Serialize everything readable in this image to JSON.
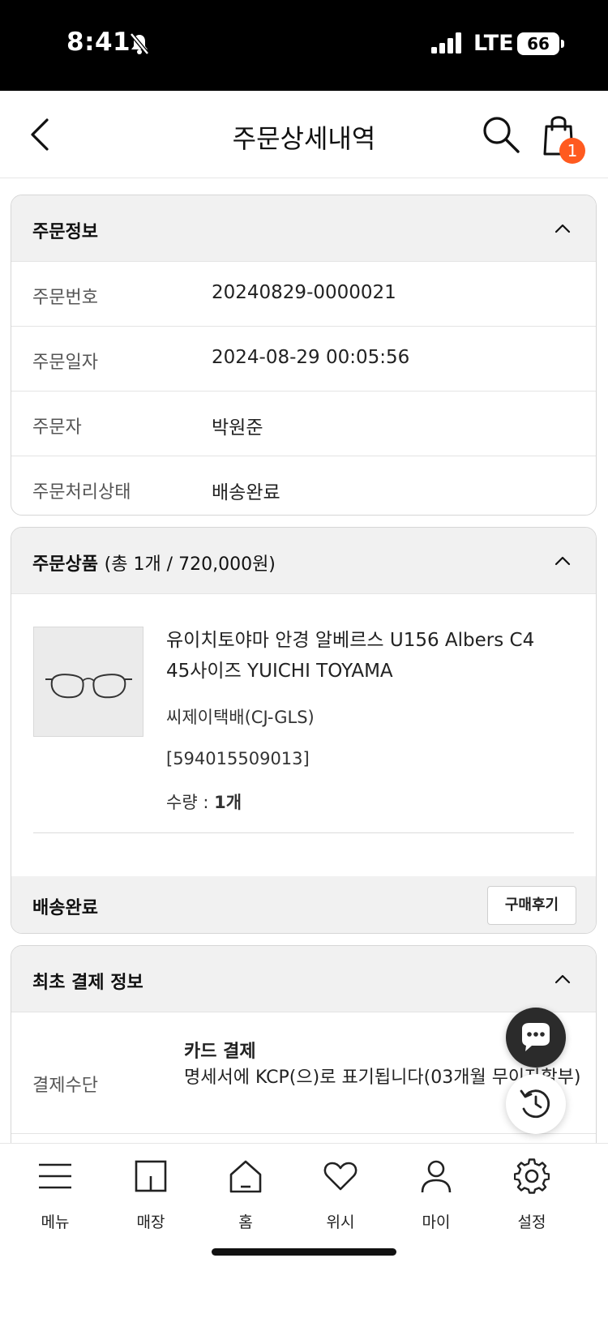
{
  "status_bar": {
    "time": "8:41",
    "network": "LTE",
    "battery": "66"
  },
  "header": {
    "title": "주문상세내역",
    "cart_count": "1"
  },
  "order_info": {
    "title": "주문정보",
    "rows": [
      {
        "label": "주문번호",
        "value": "20240829-0000021"
      },
      {
        "label": "주문일자",
        "value": "2024-08-29 00:05:56"
      },
      {
        "label": "주문자",
        "value": "박원준"
      },
      {
        "label": "주문처리상태",
        "value": "배송완료"
      }
    ]
  },
  "order_items": {
    "title": "주문상품",
    "summary": "(총 1개 / 720,000원)",
    "product": {
      "name": "유이치토야마 안경 알베르스 U156 Albers C4 45사이즈 YUICHI TOYAMA",
      "carrier": "씨제이택배(CJ-GLS)",
      "tracking": "[594015509013]",
      "qty_label": "수량 : ",
      "qty_value": "1개"
    },
    "status": "배송완료",
    "review_button": "구매후기"
  },
  "payment_info": {
    "title": "최초 결제 정보",
    "label": "결제수단",
    "method": "카드 결제",
    "description": "명세서에 KCP(으)로 표기됩니다(03개월 무이자할부)"
  },
  "tab_bar": {
    "items": [
      {
        "label": "메뉴",
        "icon": "menu-icon"
      },
      {
        "label": "매장",
        "icon": "store-icon"
      },
      {
        "label": "홈",
        "icon": "home-icon"
      },
      {
        "label": "위시",
        "icon": "heart-icon"
      },
      {
        "label": "마이",
        "icon": "person-icon"
      },
      {
        "label": "설정",
        "icon": "gear-icon"
      }
    ]
  },
  "colors": {
    "badge": "#ff5a1f",
    "chat_fab": "#2b2b2b",
    "section_header_bg": "#f1f1f1"
  }
}
